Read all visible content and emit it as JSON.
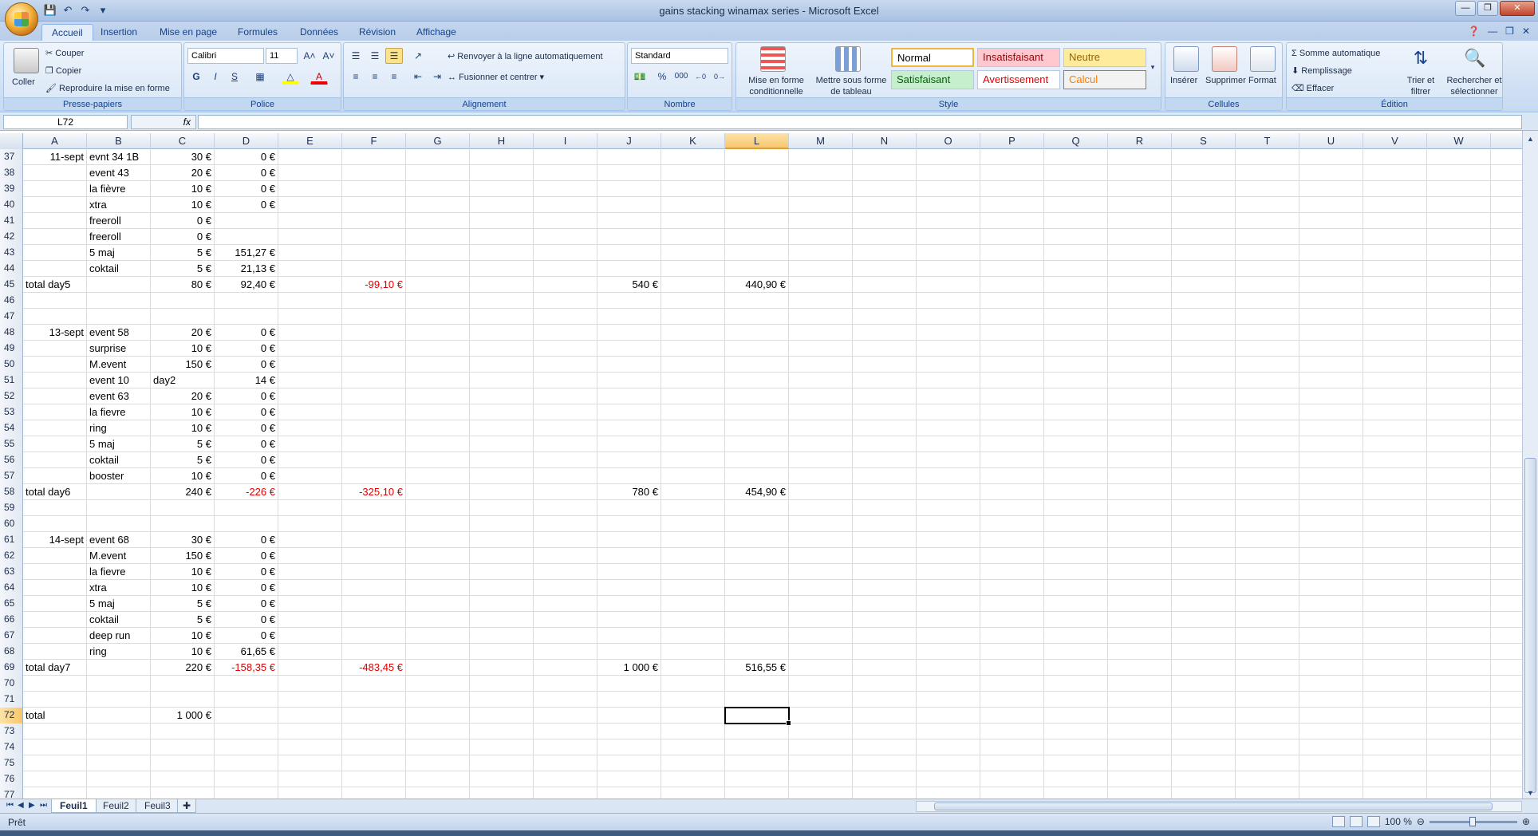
{
  "window": {
    "title": "gains stacking winamax series - Microsoft Excel"
  },
  "tabs": [
    "Accueil",
    "Insertion",
    "Mise en page",
    "Formules",
    "Données",
    "Révision",
    "Affichage"
  ],
  "ribbon": {
    "clipboard": {
      "label": "Presse-papiers",
      "paste": "Coller",
      "cut": "Couper",
      "copy": "Copier",
      "format_painter": "Reproduire la mise en forme"
    },
    "font": {
      "label": "Police",
      "name": "Calibri",
      "size": "11",
      "bold": "G",
      "italic": "I",
      "underline": "S"
    },
    "alignment": {
      "label": "Alignement",
      "wrap": "Renvoyer à la ligne automatiquement",
      "merge": "Fusionner et centrer"
    },
    "number": {
      "label": "Nombre",
      "format": "Standard",
      "percent": "%",
      "thousands": "000"
    },
    "styles": {
      "label": "Style",
      "conditional_1": "Mise en forme",
      "conditional_2": "conditionnelle",
      "table_1": "Mettre sous forme",
      "table_2": "de tableau",
      "normal": "Normal",
      "bad": "Insatisfaisant",
      "neutral": "Neutre",
      "good": "Satisfaisant",
      "warning": "Avertissement",
      "calc": "Calcul"
    },
    "cells": {
      "label": "Cellules",
      "insert": "Insérer",
      "delete": "Supprimer",
      "format": "Format"
    },
    "editing": {
      "label": "Édition",
      "autosum": "Somme automatique",
      "fill": "Remplissage",
      "clear": "Effacer",
      "sort_1": "Trier et",
      "sort_2": "filtrer",
      "find_1": "Rechercher et",
      "find_2": "sélectionner"
    }
  },
  "formula_bar": {
    "name_box": "L72",
    "fx": "fx",
    "value": ""
  },
  "columns": [
    "A",
    "B",
    "C",
    "D",
    "E",
    "F",
    "G",
    "H",
    "I",
    "J",
    "K",
    "L",
    "M",
    "N",
    "O",
    "P",
    "Q",
    "R",
    "S",
    "T",
    "U",
    "V",
    "W"
  ],
  "selected_column": "L",
  "selected_row": "72",
  "rows": [
    {
      "n": "37",
      "A": "11-sept",
      "B": "evnt 34 1B",
      "C": "30 €",
      "D": "0 €"
    },
    {
      "n": "38",
      "B": "event 43",
      "C": "20 €",
      "D": "0 €"
    },
    {
      "n": "39",
      "B": "la fièvre",
      "C": "10 €",
      "D": "0 €"
    },
    {
      "n": "40",
      "B": "xtra",
      "C": "10 €",
      "D": "0 €"
    },
    {
      "n": "41",
      "B": "freeroll",
      "C": "0 €"
    },
    {
      "n": "42",
      "B": "freeroll",
      "C": "0 €"
    },
    {
      "n": "43",
      "B": "5 maj",
      "C": "5 €",
      "D": "151,27 €"
    },
    {
      "n": "44",
      "B": "coktail",
      "C": "5 €",
      "D": "21,13 €"
    },
    {
      "n": "45",
      "A": "total day5",
      "C": "80 €",
      "D": "92,40 €",
      "F": "-99,10 €",
      "J": "540 €",
      "L": "440,90 €"
    },
    {
      "n": "46"
    },
    {
      "n": "47"
    },
    {
      "n": "48",
      "A": "13-sept",
      "B": "event 58",
      "C": "20 €",
      "D": "0 €"
    },
    {
      "n": "49",
      "B": "surprise",
      "C": "10 €",
      "D": "0 €"
    },
    {
      "n": "50",
      "B": "M.event",
      "C": "150 €",
      "D": "0 €"
    },
    {
      "n": "51",
      "B": "event 10",
      "C": "day2",
      "D": "14 €"
    },
    {
      "n": "52",
      "B": "event 63",
      "C": "20 €",
      "D": "0 €"
    },
    {
      "n": "53",
      "B": "la fievre",
      "C": "10 €",
      "D": "0 €"
    },
    {
      "n": "54",
      "B": "ring",
      "C": "10 €",
      "D": "0 €"
    },
    {
      "n": "55",
      "B": "5 maj",
      "C": "5 €",
      "D": "0 €"
    },
    {
      "n": "56",
      "B": "coktail",
      "C": "5 €",
      "D": "0 €"
    },
    {
      "n": "57",
      "B": "booster",
      "C": "10 €",
      "D": "0 €"
    },
    {
      "n": "58",
      "A": "total day6",
      "C": "240 €",
      "D": "-226 €",
      "F": "-325,10 €",
      "J": "780 €",
      "L": "454,90 €"
    },
    {
      "n": "59"
    },
    {
      "n": "60"
    },
    {
      "n": "61",
      "A": "14-sept",
      "B": "event 68",
      "C": "30 €",
      "D": "0 €"
    },
    {
      "n": "62",
      "B": "M.event",
      "C": "150 €",
      "D": "0 €"
    },
    {
      "n": "63",
      "B": "la fievre",
      "C": "10 €",
      "D": "0 €"
    },
    {
      "n": "64",
      "B": "xtra",
      "C": "10 €",
      "D": "0 €"
    },
    {
      "n": "65",
      "B": "5 maj",
      "C": "5 €",
      "D": "0 €"
    },
    {
      "n": "66",
      "B": "coktail",
      "C": "5 €",
      "D": "0 €"
    },
    {
      "n": "67",
      "B": "deep run",
      "C": "10 €",
      "D": "0 €"
    },
    {
      "n": "68",
      "B": "ring",
      "C": "10 €",
      "D": "61,65 €"
    },
    {
      "n": "69",
      "A": "total day7",
      "C": "220 €",
      "D": "-158,35 €",
      "F": "-483,45 €",
      "J": "1 000 €",
      "L": "516,55 €"
    },
    {
      "n": "70"
    },
    {
      "n": "71"
    },
    {
      "n": "72",
      "A": "total",
      "C": "1 000 €"
    },
    {
      "n": "73"
    },
    {
      "n": "74"
    },
    {
      "n": "75"
    },
    {
      "n": "76"
    },
    {
      "n": "77"
    }
  ],
  "sheets": [
    "Feuil1",
    "Feuil2",
    "Feuil3"
  ],
  "active_sheet": "Feuil1",
  "status": {
    "ready": "Prêt",
    "zoom": "100 %"
  },
  "colors": {
    "negative": "#e00000",
    "selection": "#f8c66c",
    "ribbon": "#d2e1f4"
  }
}
